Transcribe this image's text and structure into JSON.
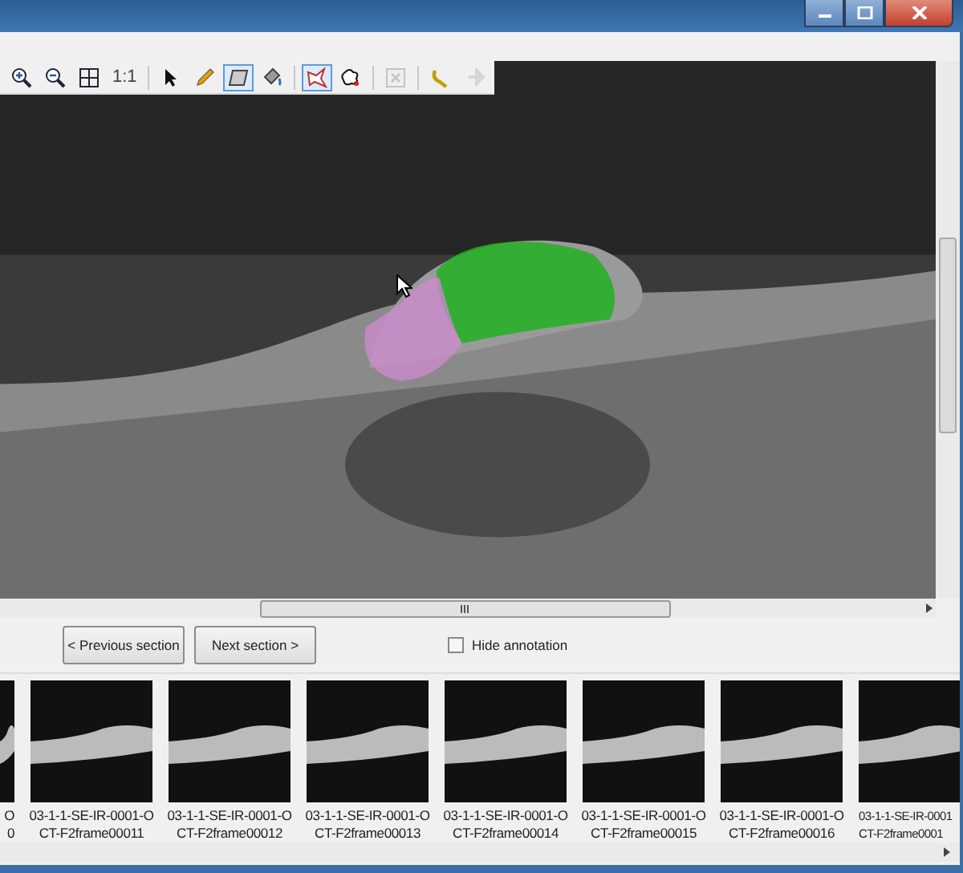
{
  "toolbar": [
    {
      "kind": "zoom-in",
      "selected": false,
      "disabled": false
    },
    {
      "kind": "zoom-out",
      "selected": false,
      "disabled": false
    },
    {
      "kind": "fit",
      "selected": false,
      "disabled": false
    },
    {
      "kind": "text",
      "label": "1:1",
      "selected": false,
      "disabled": false
    },
    {
      "kind": "separator"
    },
    {
      "kind": "pointer",
      "selected": false,
      "disabled": false
    },
    {
      "kind": "pencil",
      "selected": false,
      "disabled": false
    },
    {
      "kind": "polygon",
      "selected": true,
      "disabled": false
    },
    {
      "kind": "fill",
      "selected": false,
      "disabled": false
    },
    {
      "kind": "separator"
    },
    {
      "kind": "lasso",
      "selected": true,
      "disabled": false
    },
    {
      "kind": "blob",
      "selected": false,
      "disabled": false
    },
    {
      "kind": "separator"
    },
    {
      "kind": "delete",
      "selected": false,
      "disabled": true
    },
    {
      "kind": "separator"
    },
    {
      "kind": "undo",
      "selected": false,
      "disabled": false
    },
    {
      "kind": "redo",
      "selected": false,
      "disabled": true
    }
  ],
  "buttons": [
    "< Previous section",
    "Next section >"
  ],
  "hide_annotation": {
    "label": "Hide annotation",
    "checked": false
  },
  "thumbnails": [
    {
      "lines": [
        "O",
        "0"
      ]
    },
    {
      "lines": [
        "03-1-1-SE-IR-0001-O",
        "CT-F2frame00011"
      ]
    },
    {
      "lines": [
        "03-1-1-SE-IR-0001-O",
        "CT-F2frame00012"
      ]
    },
    {
      "lines": [
        "03-1-1-SE-IR-0001-O",
        "CT-F2frame00013"
      ]
    },
    {
      "lines": [
        "03-1-1-SE-IR-0001-O",
        "CT-F2frame00014"
      ]
    },
    {
      "lines": [
        "03-1-1-SE-IR-0001-O",
        "CT-F2frame00015"
      ]
    },
    {
      "lines": [
        "03-1-1-SE-IR-0001-O",
        "CT-F2frame00016"
      ]
    },
    {
      "lines": [
        "03-1-1-SE-IR-0001",
        "CT-F2frame0001"
      ]
    }
  ]
}
